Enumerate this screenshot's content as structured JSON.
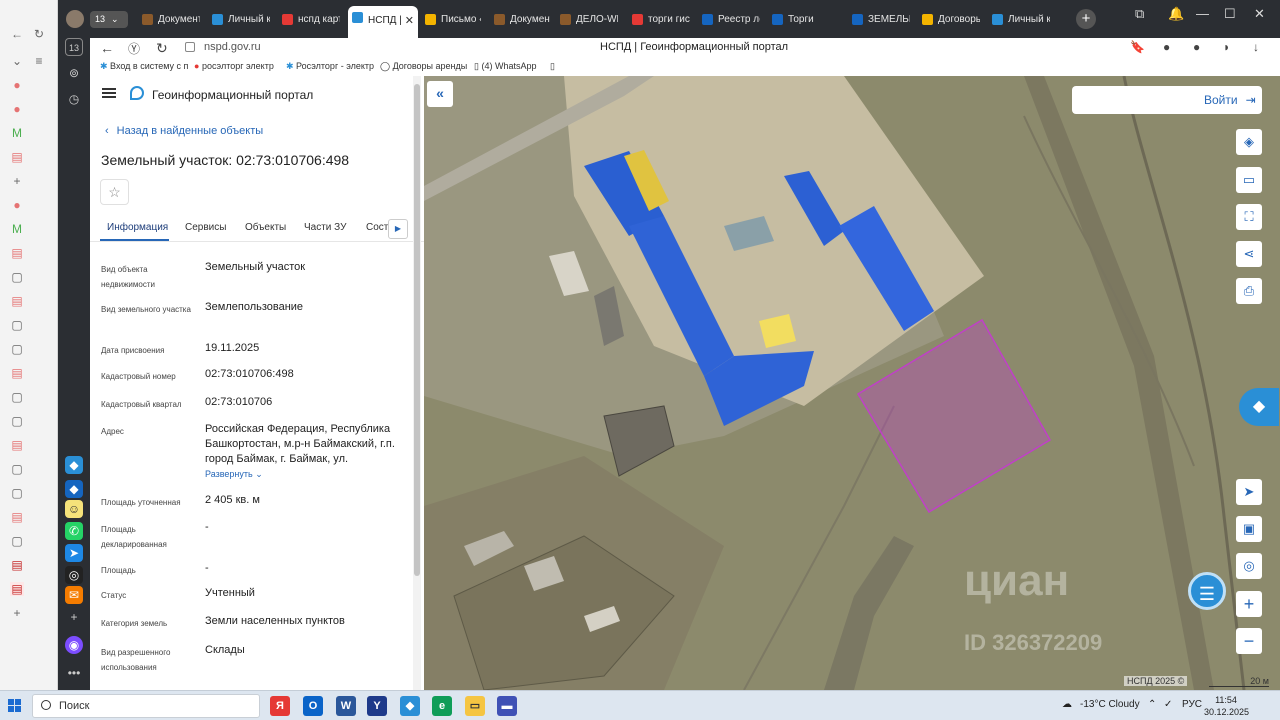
{
  "browser": {
    "tab_counter": "13",
    "tabs": [
      {
        "label": "Документ",
        "color": "#8b5a2b"
      },
      {
        "label": "Личный к",
        "color": "#2a8fd6"
      },
      {
        "label": "нспд карт",
        "color": "#e53935"
      },
      {
        "label": "НСПД |",
        "color": "#2a8fd6",
        "active": true
      },
      {
        "label": "Письмо «",
        "color": "#f4b400"
      },
      {
        "label": "Документ",
        "color": "#8b5a2b"
      },
      {
        "label": "ДЕЛО-WEI",
        "color": "#8b5a2b"
      },
      {
        "label": "торги гис",
        "color": "#e53935"
      },
      {
        "label": "Реестр ло",
        "color": "#1565c0"
      },
      {
        "label": "Торги",
        "color": "#1565c0"
      },
      {
        "label": "ЗЕМЕЛЬН",
        "color": "#1565c0"
      },
      {
        "label": "Договоры",
        "color": "#f4b400"
      },
      {
        "label": "Личный к",
        "color": "#2a8fd6"
      }
    ],
    "url": "nspd.gov.ru",
    "page_title": "НСПД | Геоинформационный портал",
    "bookmarks": [
      "Вход в систему с п",
      "росэлторг электр",
      "Росэлторг - электр",
      "Договоры аренды",
      "(4) WhatsApp"
    ]
  },
  "panel": {
    "portal_title": "Геоинформационный портал",
    "back_label": "Назад в найденные объекты",
    "object_title": "Земельный участок: 02:73:010706:498",
    "tabs": [
      "Информация",
      "Сервисы",
      "Объекты",
      "Части ЗУ",
      "Состав"
    ],
    "rows": [
      {
        "label": "Вид объекта недвижимости",
        "value": "Земельный участок"
      },
      {
        "label": "Вид земельного участка",
        "value": "Землепользование"
      },
      {
        "label": "Дата присвоения",
        "value": "19.11.2025"
      },
      {
        "label": "Кадастровый номер",
        "value": "02:73:010706:498"
      },
      {
        "label": "Кадастровый квартал",
        "value": "02:73:010706"
      },
      {
        "label": "Адрес",
        "value": "Российская Федерация, Республика Башкортостан, м.р-н Баймакский, г.п. город Баймак, г. Баймак, ул."
      },
      {
        "label": "Площадь уточненная",
        "value": "2 405 кв. м"
      },
      {
        "label": "Площадь декларированная",
        "value": "-"
      },
      {
        "label": "Площадь",
        "value": "-"
      },
      {
        "label": "Статус",
        "value": "Учтенный"
      },
      {
        "label": "Категория земель",
        "value": "Земли населенных пунктов"
      },
      {
        "label": "Вид разрешенного использования",
        "value": "Склады"
      }
    ],
    "expand_label": "Развернуть"
  },
  "map": {
    "login_label": "Войти",
    "watermark": "циан",
    "watermark_id": "ID 326372209",
    "attribution": "НСПД 2025 ©",
    "scale_label": "20 м",
    "parcel_color": "#c040c8"
  },
  "taskbar": {
    "search_label": "Поиск",
    "weather": "-13°C  Cloudy",
    "lang": "РУС",
    "time": "11:54",
    "date": "30.12.2025"
  }
}
